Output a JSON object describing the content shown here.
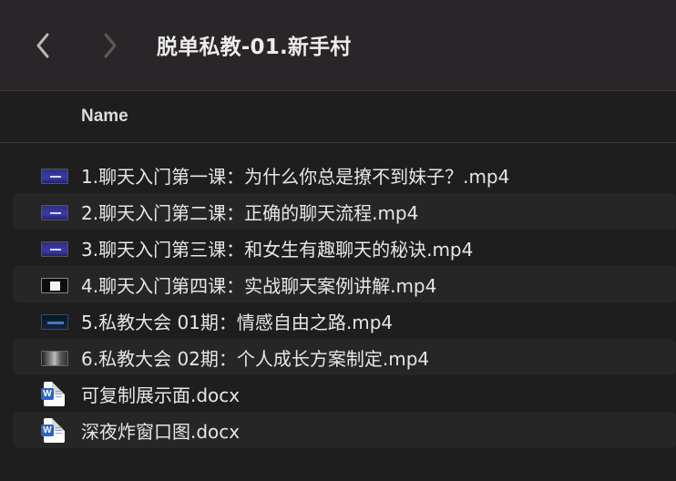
{
  "toolbar": {
    "title": "脱单私教-01.新手村",
    "back_icon": "chevron-left-icon",
    "forward_icon": "chevron-right-icon"
  },
  "columns": {
    "name": "Name"
  },
  "files": [
    {
      "name": "1.聊天入门第一课：为什么你总是撩不到妹子？.mp4",
      "icon": "video-thumbnail-icon",
      "thumb": "blue"
    },
    {
      "name": "2.聊天入门第二课：正确的聊天流程.mp4",
      "icon": "video-thumbnail-icon",
      "thumb": "blue"
    },
    {
      "name": "3.聊天入门第三课：和女生有趣聊天的秘诀.mp4",
      "icon": "video-thumbnail-icon",
      "thumb": "blue"
    },
    {
      "name": "4.聊天入门第四课：实战聊天案例讲解.mp4",
      "icon": "video-thumbnail-icon",
      "thumb": "white"
    },
    {
      "name": "5.私教大会 01期：情感自由之路.mp4",
      "icon": "video-thumbnail-icon",
      "thumb": "dark"
    },
    {
      "name": "6.私教大会 02期：个人成长方案制定.mp4",
      "icon": "video-thumbnail-icon",
      "thumb": "photo"
    },
    {
      "name": "可复制展示面.docx",
      "icon": "word-document-icon",
      "badge": "W"
    },
    {
      "name": "深夜炸窗口图.docx",
      "icon": "word-document-icon",
      "badge": "W"
    }
  ],
  "colors": {
    "toolbar_bg": "#2a2528",
    "window_bg": "#1e1e1e",
    "alt_row_bg": "#262626",
    "word_blue": "#2b66c2"
  }
}
